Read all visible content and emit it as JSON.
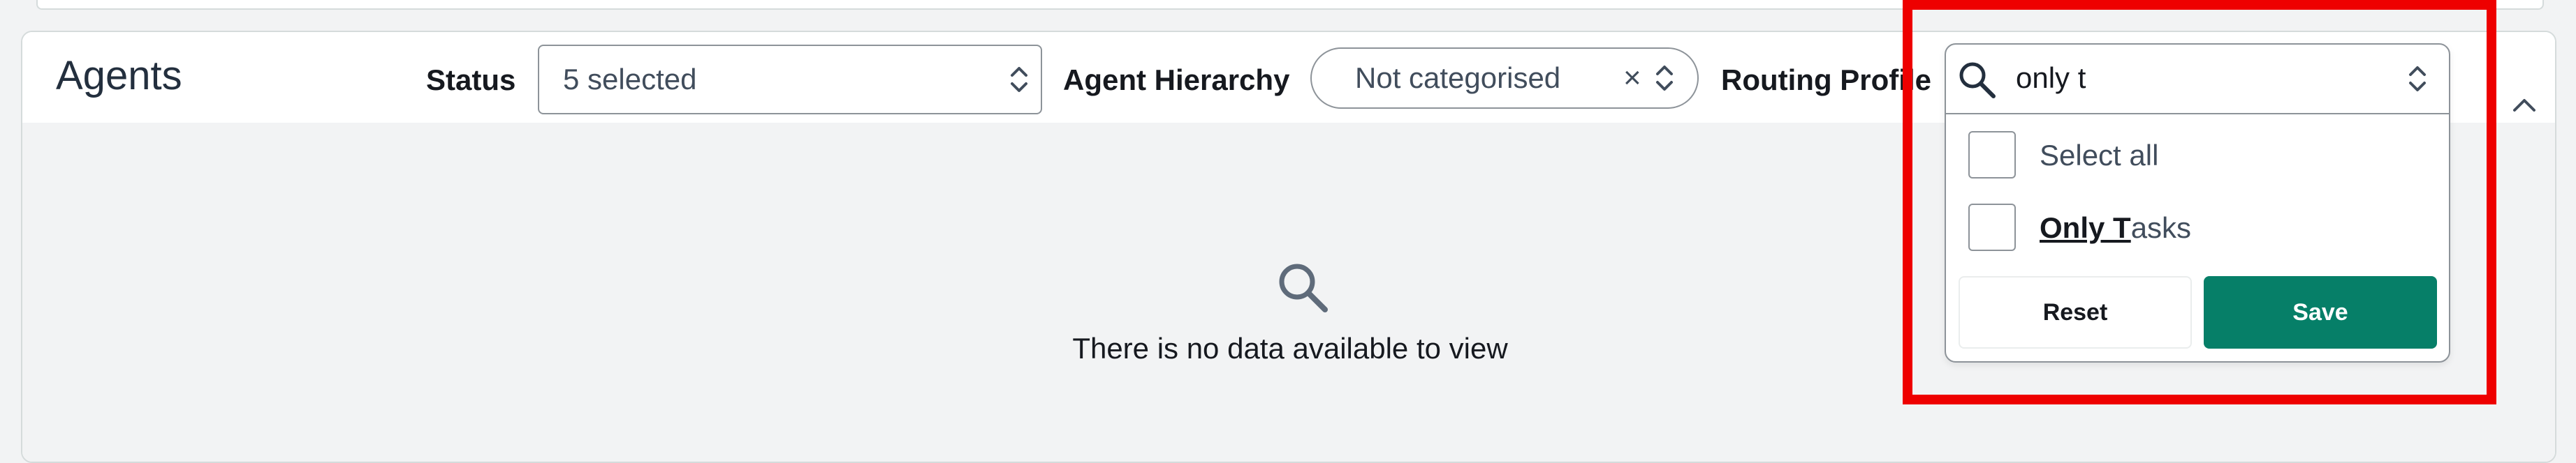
{
  "panel": {
    "title": "Agents"
  },
  "filters": {
    "status": {
      "label": "Status",
      "value": "5 selected"
    },
    "agent_hierarchy": {
      "label": "Agent Hierarchy",
      "value": "Not categorised",
      "clear_symbol": "×"
    },
    "routing_profile": {
      "label": "Routing Profile"
    }
  },
  "dropdown": {
    "search_value": "only t",
    "options": [
      {
        "label": "Select all",
        "checked": false
      },
      {
        "label_match": "Only T",
        "label_rest": "asks",
        "checked": false
      }
    ],
    "reset_label": "Reset",
    "save_label": "Save"
  },
  "empty_state": {
    "message": "There is no data available to view",
    "icon": "search-icon"
  },
  "colors": {
    "primary": "#067f68",
    "highlight": "#ee0000",
    "border": "#8d9399",
    "background": "#f2f3f4"
  }
}
